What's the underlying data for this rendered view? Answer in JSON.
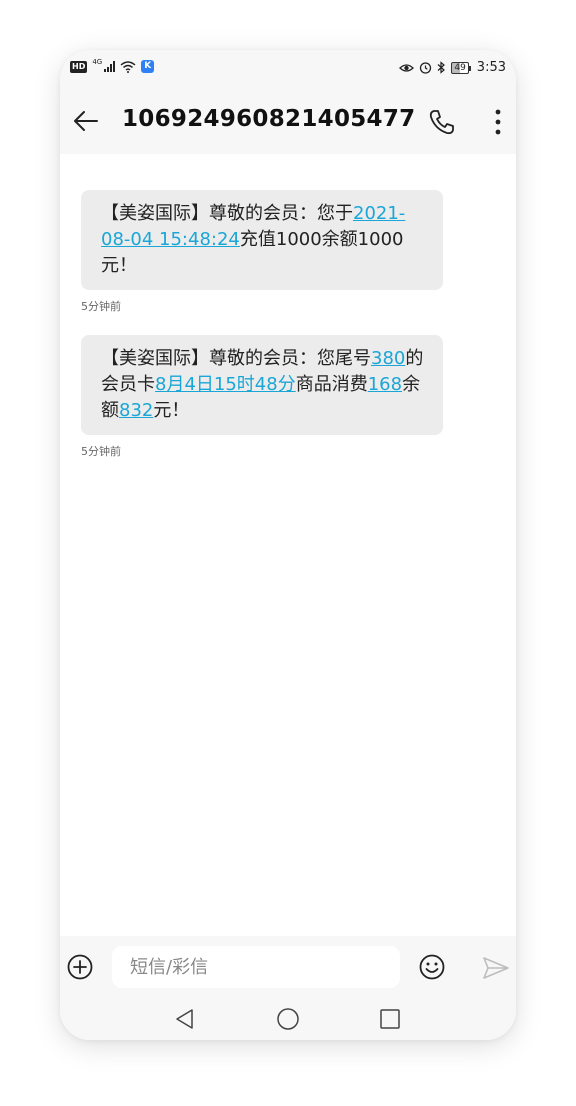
{
  "status_bar": {
    "hd_label": "HD",
    "network_label": "4G",
    "battery_level": "49",
    "time": "3:53"
  },
  "header": {
    "title": "106924960821405477"
  },
  "messages": [
    {
      "seg_1": "【美姿国际】尊敬的会员：您于",
      "link_1": "2021-08-04 15:48:24",
      "seg_2": "充值1000余额1000元！",
      "time": "5分钟前"
    },
    {
      "seg_1": "【美姿国际】尊敬的会员：您尾号",
      "link_1": "380",
      "seg_2": "的会员卡",
      "link_2": "8月4日15时48分",
      "seg_3": "商品消费",
      "link_3": "168",
      "seg_4": "余额",
      "link_4": "832",
      "seg_5": "元！",
      "time": "5分钟前"
    }
  ],
  "compose": {
    "placeholder": "短信/彩信"
  },
  "colors": {
    "link": "#1aa6d6",
    "bubble": "#ececec",
    "bar": "#f7f7f7"
  },
  "icons": {
    "back": "arrow-left-icon",
    "call": "phone-icon",
    "more": "more-vertical-icon",
    "add": "plus-circle-icon",
    "emoji": "smiley-icon",
    "send": "send-icon"
  }
}
